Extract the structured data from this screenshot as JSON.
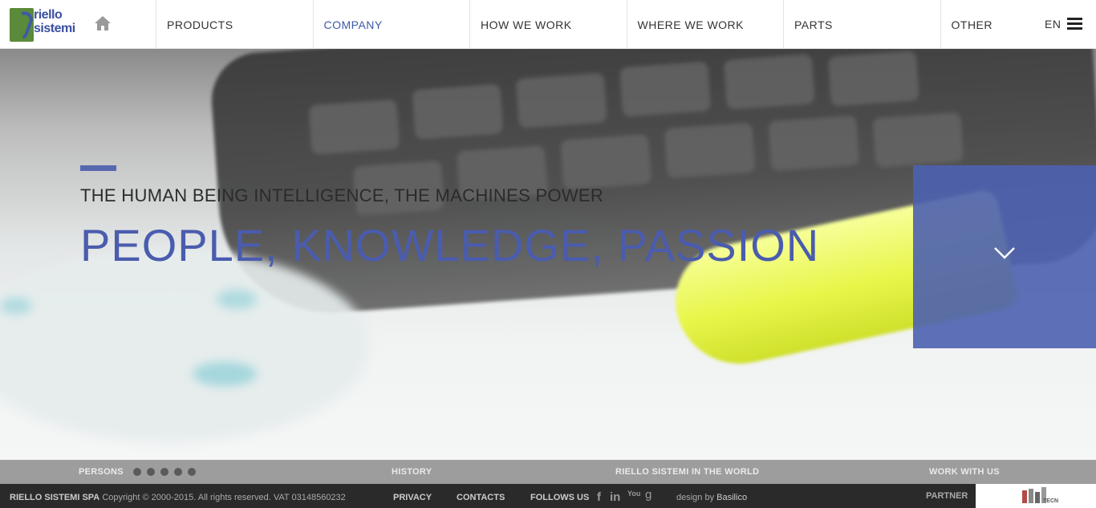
{
  "brand": {
    "logo_line1": "riello",
    "logo_line2": "sistemi",
    "logo_color": "#3a4fa0",
    "logo_bg": "#5b8a3a"
  },
  "header": {
    "home_icon": "home-icon",
    "nav": [
      {
        "label": "PRODUCTS",
        "active": false
      },
      {
        "label": "COMPANY",
        "active": true
      },
      {
        "label": "HOW WE WORK",
        "active": false
      },
      {
        "label": "WHERE WE WORK",
        "active": false
      },
      {
        "label": "PARTS",
        "active": false
      },
      {
        "label": "OTHER",
        "active": false
      }
    ],
    "lang": "EN",
    "menu_icon": "hamburger-menu-icon",
    "active_color": "#3e5aa8"
  },
  "hero": {
    "subtitle": "THE HUMAN BEING INTELLIGENCE, THE MACHINES POWER",
    "title": "PEOPLE, KNOWLEDGE, PASSION",
    "accent_color": "#5568b0",
    "scroll_icon": "chevron-down-icon"
  },
  "subnav": {
    "persons": "PERSONS",
    "history": "HISTORY",
    "world": "RIELLO SISTEMI IN THE WORLD",
    "work": "WORK WITH US",
    "slide_count": 5
  },
  "footer": {
    "company": "RIELLO SISTEMI SPA",
    "copyright": "Copyright © 2000-2015. All rights reserved. VAT 03148560232",
    "privacy": "PRIVACY",
    "contacts": "CONTACTS",
    "follow": "FOLLOWS US",
    "social": [
      {
        "icon": "facebook-icon",
        "glyph": "f"
      },
      {
        "icon": "linkedin-icon",
        "glyph": "in"
      },
      {
        "icon": "youtube-icon",
        "glyph": "You"
      },
      {
        "icon": "googleplus-icon",
        "glyph": "g"
      }
    ],
    "design_prefix": "design by",
    "design_by": "Basilico",
    "partner": "PARTNER",
    "partner_logo_text": "TECN"
  }
}
